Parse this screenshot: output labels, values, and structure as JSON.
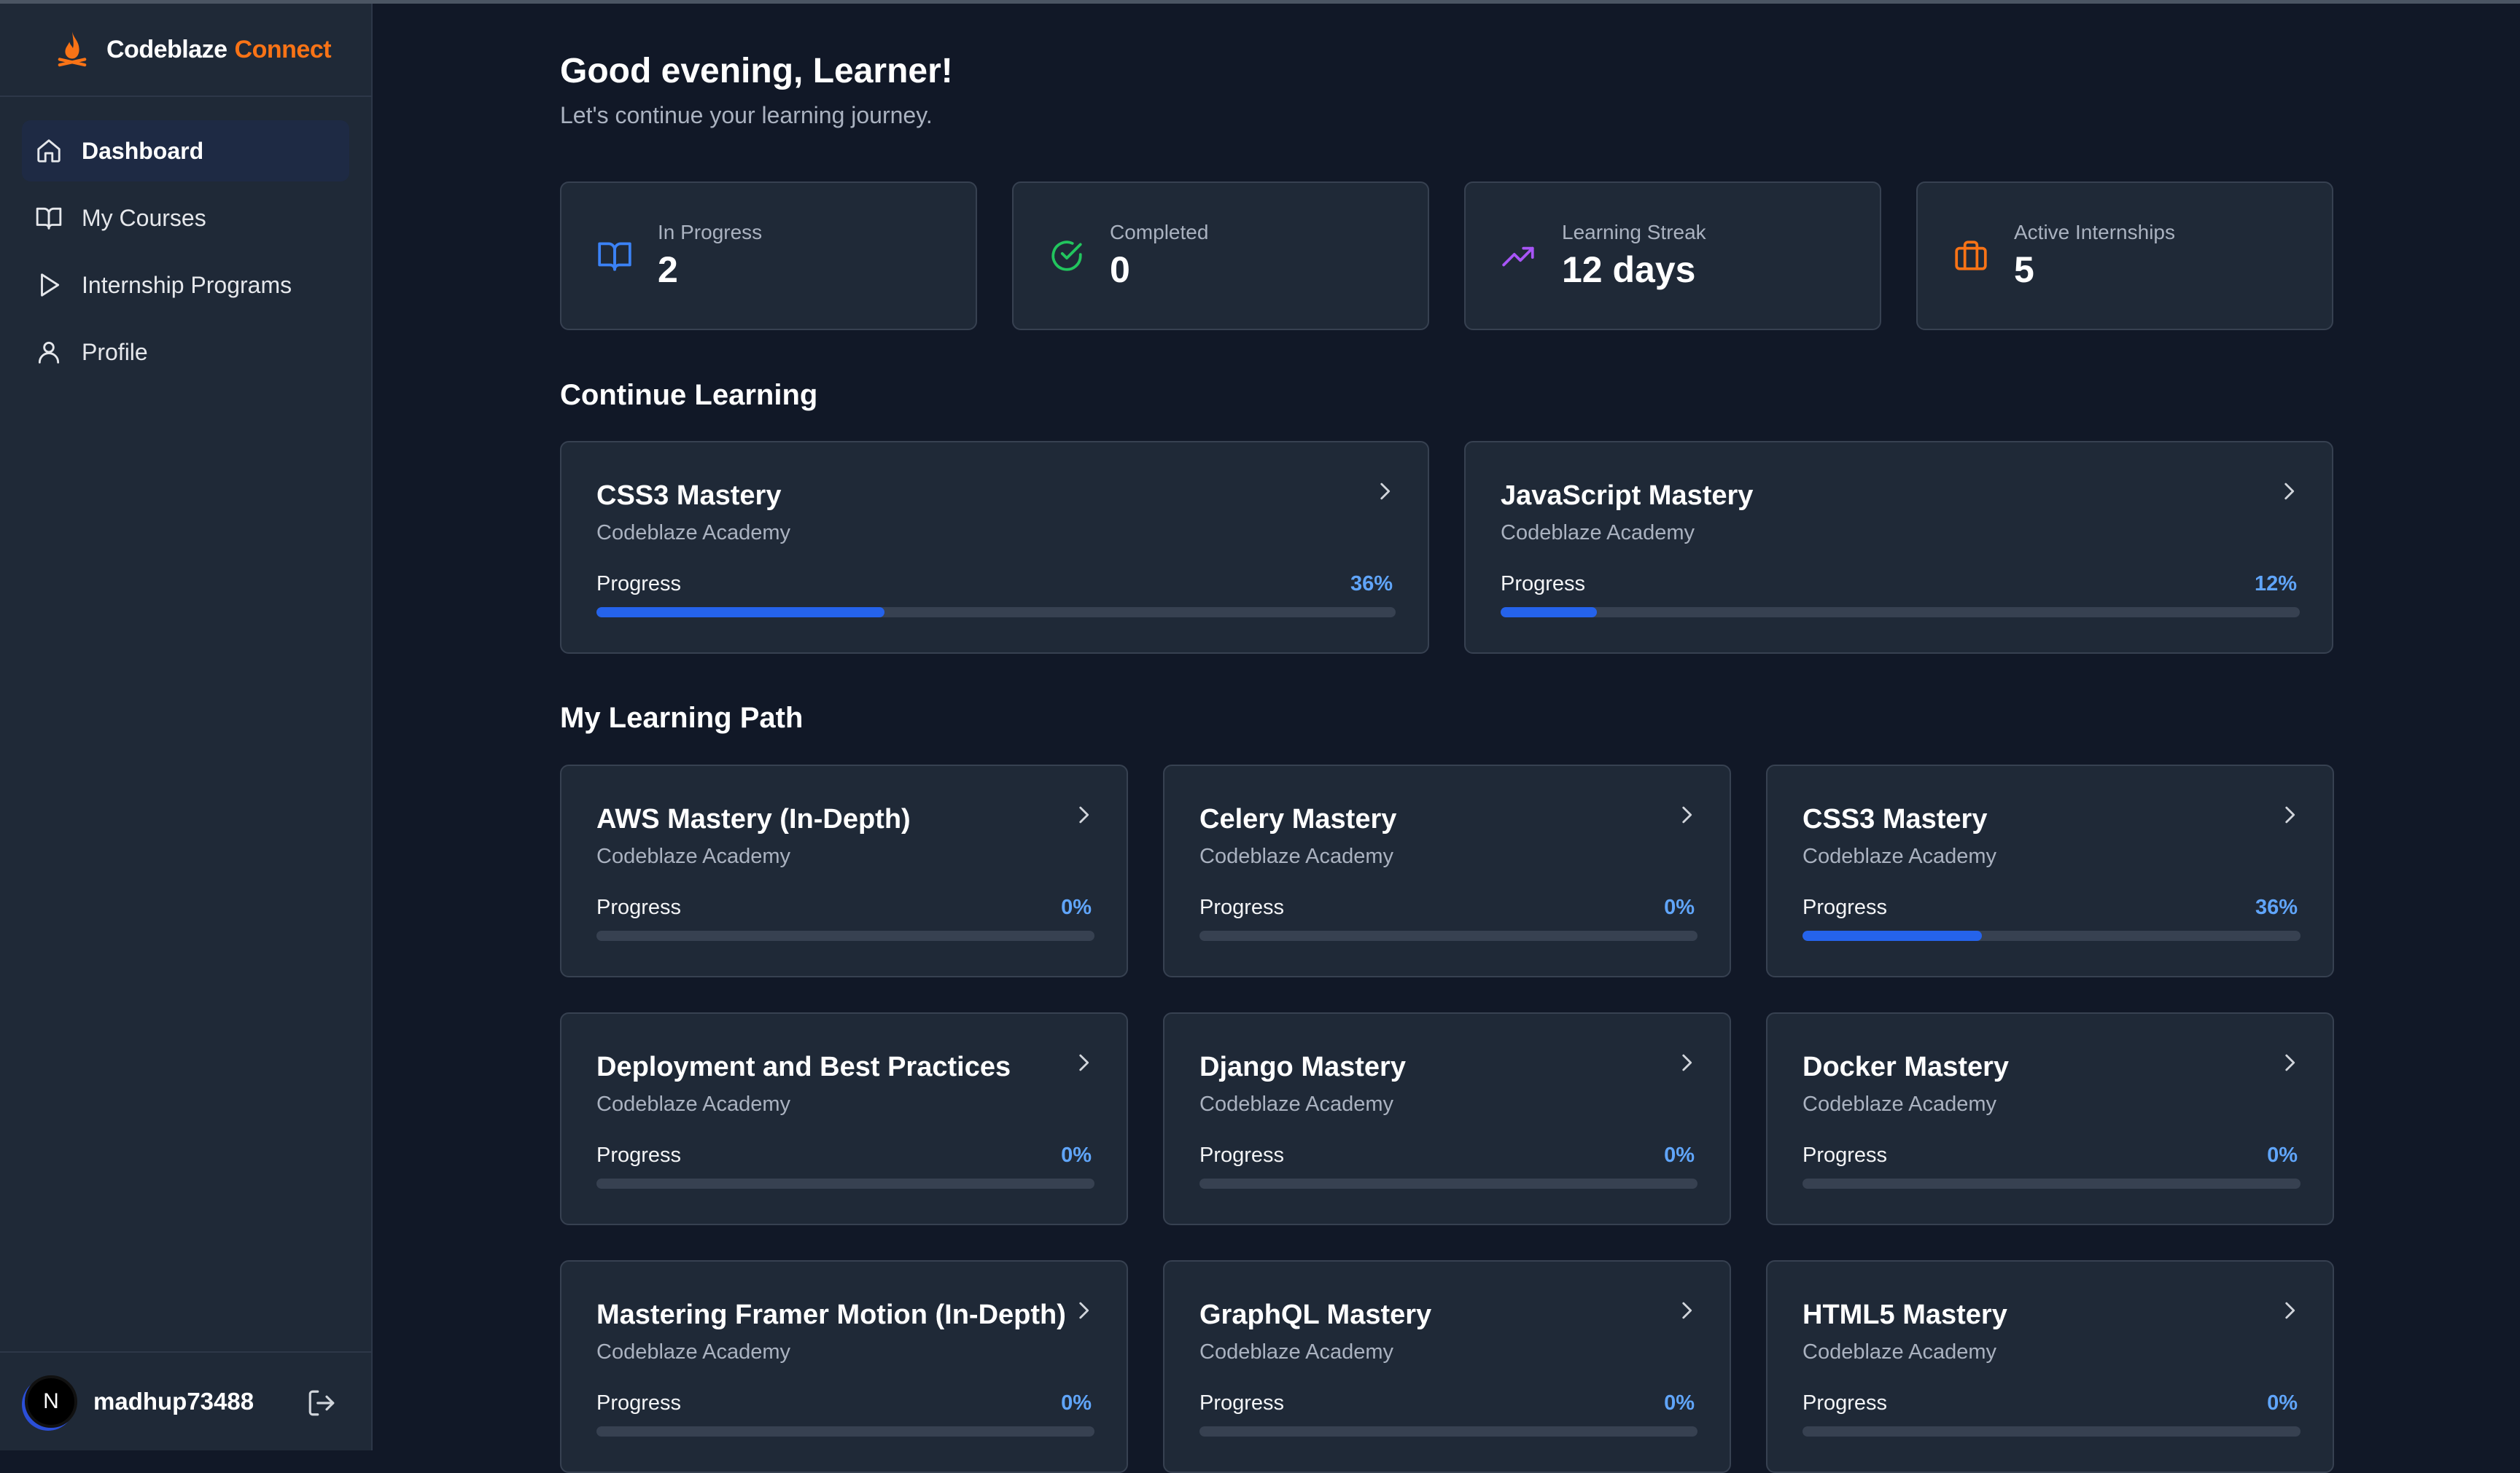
{
  "brand": {
    "name": "Codeblaze",
    "accent": "Connect"
  },
  "sidebar": {
    "items": [
      {
        "label": "Dashboard",
        "icon": "home-icon",
        "active": true
      },
      {
        "label": "My Courses",
        "icon": "book-open-icon",
        "active": false
      },
      {
        "label": "Internship Programs",
        "icon": "play-icon",
        "active": false
      },
      {
        "label": "Profile",
        "icon": "user-icon",
        "active": false
      }
    ]
  },
  "user": {
    "avatar_letter": "N",
    "name": "madhup73488"
  },
  "header": {
    "greeting": "Good evening, Learner!",
    "subtitle": "Let's continue your learning journey."
  },
  "stats": [
    {
      "label": "In Progress",
      "value": "2",
      "icon": "book-open-icon",
      "color": "#3b82f6"
    },
    {
      "label": "Completed",
      "value": "0",
      "icon": "check-circle-icon",
      "color": "#22c55e"
    },
    {
      "label": "Learning Streak",
      "value": "12 days",
      "icon": "trending-up-icon",
      "color": "#a855f7"
    },
    {
      "label": "Active Internships",
      "value": "5",
      "icon": "briefcase-icon",
      "color": "#f97316"
    }
  ],
  "continue_learning": {
    "title": "Continue Learning",
    "courses": [
      {
        "title": "CSS3 Mastery",
        "provider": "Codeblaze Academy",
        "progress_label": "Progress",
        "progress_text": "36%",
        "progress": 36
      },
      {
        "title": "JavaScript Mastery",
        "provider": "Codeblaze Academy",
        "progress_label": "Progress",
        "progress_text": "12%",
        "progress": 12
      }
    ]
  },
  "learning_path": {
    "title": "My Learning Path",
    "courses": [
      {
        "title": "AWS Mastery (In-Depth)",
        "provider": "Codeblaze Academy",
        "progress_label": "Progress",
        "progress_text": "0%",
        "progress": 0
      },
      {
        "title": "Celery Mastery",
        "provider": "Codeblaze Academy",
        "progress_label": "Progress",
        "progress_text": "0%",
        "progress": 0
      },
      {
        "title": "CSS3 Mastery",
        "provider": "Codeblaze Academy",
        "progress_label": "Progress",
        "progress_text": "36%",
        "progress": 36
      },
      {
        "title": "Deployment and Best Practices",
        "provider": "Codeblaze Academy",
        "progress_label": "Progress",
        "progress_text": "0%",
        "progress": 0
      },
      {
        "title": "Django Mastery",
        "provider": "Codeblaze Academy",
        "progress_label": "Progress",
        "progress_text": "0%",
        "progress": 0
      },
      {
        "title": "Docker Mastery",
        "provider": "Codeblaze Academy",
        "progress_label": "Progress",
        "progress_text": "0%",
        "progress": 0
      },
      {
        "title": "Mastering Framer Motion (In-Depth)",
        "provider": "Codeblaze Academy",
        "progress_label": "Progress",
        "progress_text": "0%",
        "progress": 0
      },
      {
        "title": "GraphQL Mastery",
        "provider": "Codeblaze Academy",
        "progress_label": "Progress",
        "progress_text": "0%",
        "progress": 0
      },
      {
        "title": "HTML5 Mastery",
        "provider": "Codeblaze Academy",
        "progress_label": "Progress",
        "progress_text": "0%",
        "progress": 0
      }
    ]
  }
}
